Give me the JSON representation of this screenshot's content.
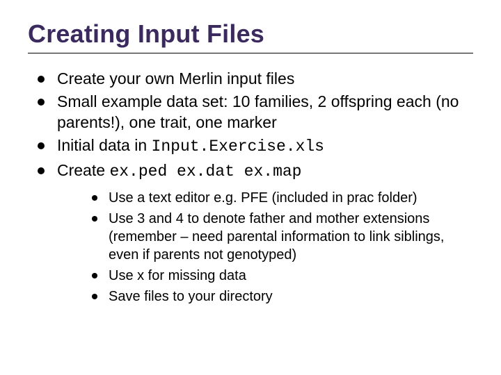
{
  "title": "Creating Input Files",
  "bullets": {
    "b1": "Create your own Merlin input files",
    "b2": "Small example data set: 10 families, 2 offspring each (no parents!), one trait, one marker",
    "b3_pre": "Initial data in ",
    "b3_code": "Input.Exercise.xls",
    "b4_pre": "Create ",
    "b4_code": "ex.ped ex.dat ex.map"
  },
  "sub": {
    "s1": "Use a text editor e.g. PFE (included in prac folder)",
    "s2": "Use 3 and 4 to denote father and mother extensions (remember – need parental information to link siblings, even if parents not genotyped)",
    "s3": "Use x for missing data",
    "s4": "Save files to your directory"
  }
}
